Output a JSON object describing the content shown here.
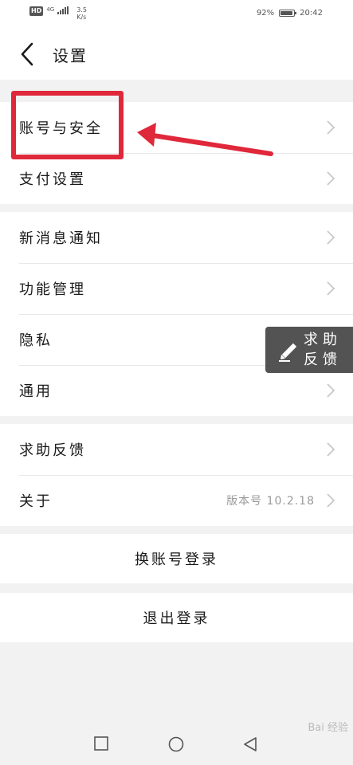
{
  "status_bar": {
    "hd": "HD",
    "network": "4G",
    "speed_value": "3.5",
    "speed_unit": "K/s",
    "battery_percent": "92%",
    "battery_level": 0.92,
    "time": "20:42"
  },
  "header": {
    "title": "设置"
  },
  "groups": [
    {
      "items": [
        {
          "label": "账号与安全"
        },
        {
          "label": "支付设置"
        }
      ]
    },
    {
      "items": [
        {
          "label": "新消息通知"
        },
        {
          "label": "功能管理"
        },
        {
          "label": "隐私"
        },
        {
          "label": "通用"
        }
      ]
    },
    {
      "items": [
        {
          "label": "求助反馈"
        },
        {
          "label": "关于",
          "value": "版本号 10.2.18"
        }
      ]
    }
  ],
  "buttons": {
    "switch_account": "换账号登录",
    "logout": "退出登录"
  },
  "floating": {
    "line1": "求助",
    "line2": "反馈"
  },
  "watermark": "Bai 经验",
  "colors": {
    "highlight": "#e0283b",
    "background": "#f2f2f2",
    "chevron": "#c8c8c8"
  }
}
